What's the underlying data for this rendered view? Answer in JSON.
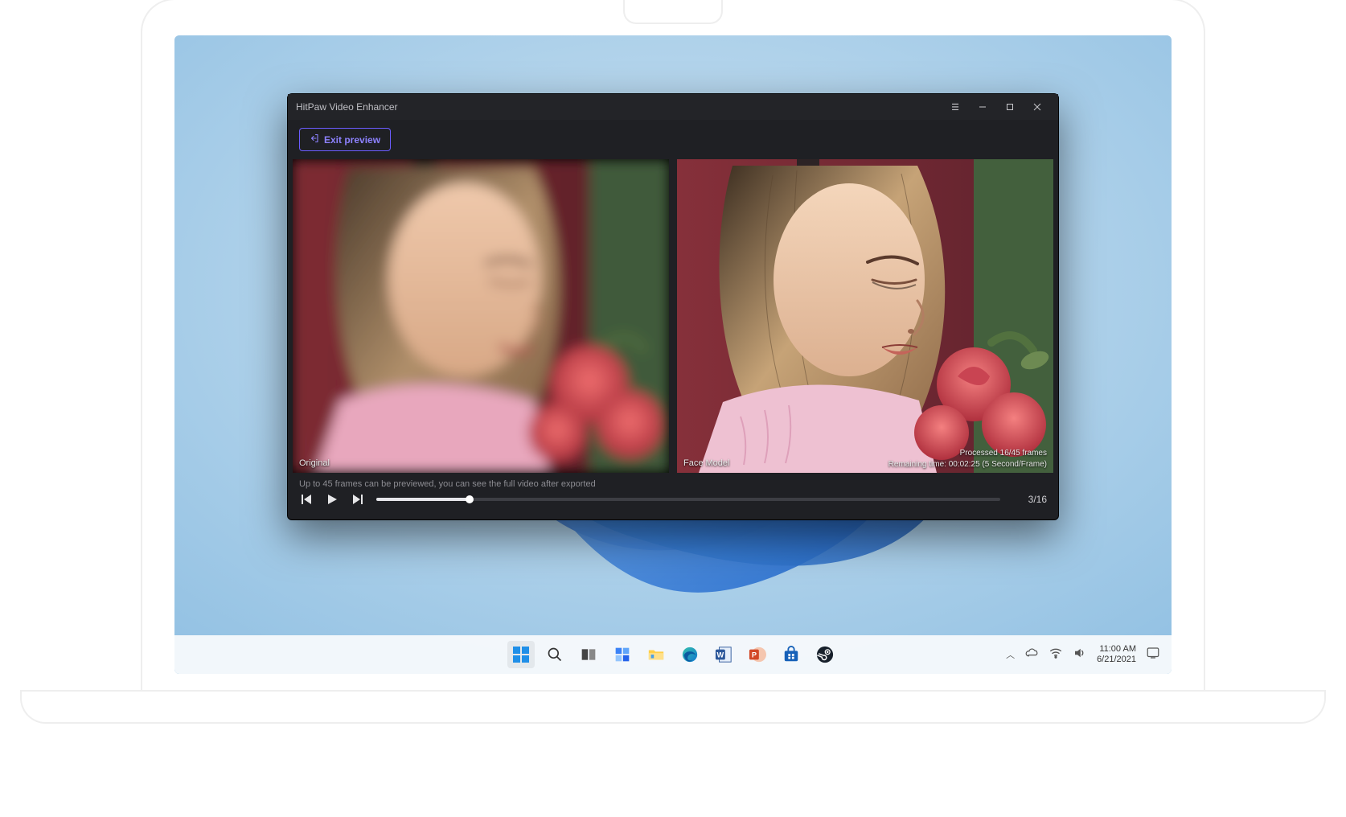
{
  "app": {
    "title": "HitPaw Video Enhancer",
    "exit_preview_label": "Exit preview",
    "preview_hint": "Up to 45 frames can be previewed, you can see the full video after exported",
    "frame_counter": "3/16",
    "panes": {
      "left_label": "Original",
      "right_label": "Face Model",
      "processed_line": "Processed 16/45 frames",
      "remaining_line": "Remaining time: 00:02:25 (5 Second/Frame)"
    },
    "progress_percent": 15
  },
  "taskbar": {
    "time": "11:00 AM",
    "date": "6/21/2021",
    "icons": {
      "start": "start-icon",
      "search": "search-icon",
      "taskview": "taskview-icon",
      "widgets": "widgets-icon",
      "explorer": "file-explorer-icon",
      "edge": "edge-icon",
      "word": "word-icon",
      "powerpoint": "powerpoint-icon",
      "store": "store-icon",
      "steam": "steam-icon"
    }
  },
  "colors": {
    "accent": "#6b5cff",
    "window_bg": "#1f2024"
  }
}
